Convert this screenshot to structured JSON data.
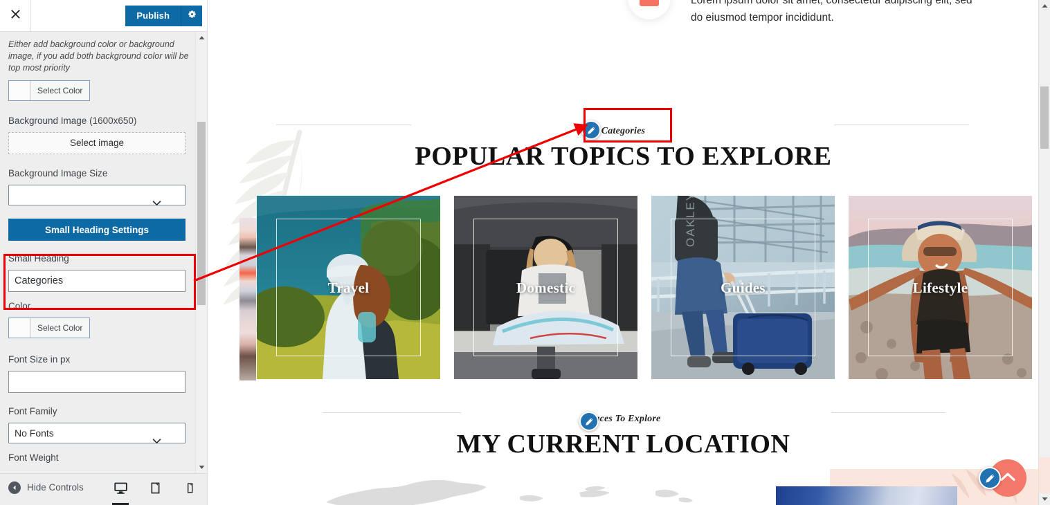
{
  "sidebar": {
    "close_icon": "close-icon",
    "publish_label": "Publish",
    "gear_icon": "gear-icon",
    "helper_text": "Either add background color or background image, if you add both background color will be top most priority",
    "bg_color": {
      "label": "Select Color"
    },
    "bg_image": {
      "label": "Background Image (1600x650)",
      "button": "Select image"
    },
    "bg_image_size": {
      "label": "Background Image Size",
      "value": ""
    },
    "small_heading_settings_button": "Small Heading Settings",
    "small_heading": {
      "label": "Small Heading",
      "value": "Categories"
    },
    "color": {
      "label": "Color",
      "button": "Select Color"
    },
    "font_size": {
      "label": "Font Size in px",
      "value": ""
    },
    "font_family": {
      "label": "Font Family",
      "value": "No Fonts"
    },
    "font_weight": {
      "label": "Font Weight"
    },
    "footer": {
      "hide_controls": "Hide Controls",
      "devices": [
        "desktop",
        "tablet",
        "mobile"
      ],
      "active_device": "desktop"
    },
    "accent_color": "#0d6aa4",
    "annotation_color": "#ee0000"
  },
  "preview": {
    "top_section": {
      "paragraph": "Lorem ipsum dolor sit amet, consectetur adipiscing elit, sed do eiusmod tempor incididunt."
    },
    "categories_section": {
      "small_heading": "Categories",
      "title": "POPULAR TOPICS TO EXPLORE",
      "edit_icon": "pencil-edit-icon",
      "cards": [
        {
          "caption": "Travel",
          "alt": "hiker-with-backpack-photo"
        },
        {
          "caption": "Domestic",
          "alt": "woman-in-car-trunk-with-map-photo"
        },
        {
          "caption": "Guides",
          "alt": "traveler-with-suitcase-at-airport-photo"
        },
        {
          "caption": "Lifestyle",
          "alt": "woman-at-beach-with-hat-photo"
        }
      ]
    },
    "location_section": {
      "small_heading": "Places To Explore",
      "title": "MY CURRENT LOCATION",
      "edit_icon": "pencil-edit-icon"
    },
    "scroll_top_button": {
      "icon": "chevron-up-icon",
      "color": "#f4796b"
    },
    "fab_edit_icon": "pencil-edit-icon"
  }
}
